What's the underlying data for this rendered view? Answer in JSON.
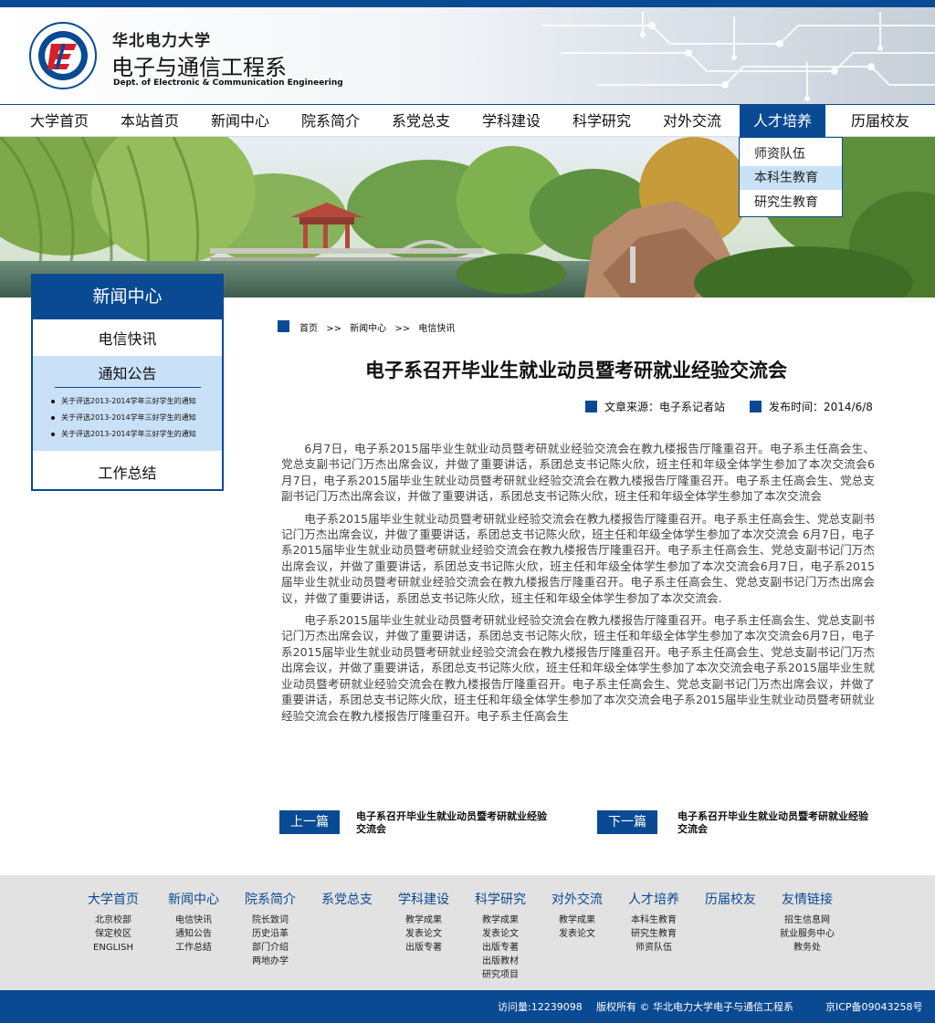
{
  "header": {
    "university_name": "华北电力大学",
    "department_title": "电子与通信工程系",
    "department_en": "Dept. of Electronic & Communication Engineering"
  },
  "nav": {
    "items": [
      "大学首页",
      "本站首页",
      "新闻中心",
      "院系简介",
      "系党总支",
      "学科建设",
      "科学研究",
      "对外交流",
      "人才培养",
      "历届校友"
    ],
    "active": "人才培养"
  },
  "dropdown": {
    "items": [
      "师资队伍",
      "本科生教育",
      "研究生教育"
    ],
    "hovered": "本科生教育"
  },
  "sidebar": {
    "title": "新闻中心",
    "item1": "电信快讯",
    "item2": "通知公告",
    "item3": "工作总结",
    "sub_items": [
      "关于评选2013-2014学年三好学生的通知",
      "关于评选2013-2014学年三好学生的通知",
      "关于评选2013-2014学年三好学生的通知"
    ]
  },
  "breadcrumb": {
    "home": "首页",
    "sep": ">>",
    "section": "新闻中心",
    "current": "电信快讯"
  },
  "article": {
    "title": "电子系召开毕业生就业动员暨考研就业经验交流会",
    "source": "文章来源：电子系记者站",
    "date": "发布时间：2014/6/8",
    "paragraphs": [
      "6月7日，电子系2015届毕业生就业动员暨考研就业经验交流会在教九楼报告厅隆重召开。电子系主任高会生、党总支副书记门万杰出席会议，并做了重要讲话，系团总支书记陈火欣，班主任和年级全体学生参加了本次交流会6月7日，电子系2015届毕业生就业动员暨考研就业经验交流会在教九楼报告厅隆重召开。电子系主任高会生、党总支副书记门万杰出席会议，并做了重要讲话，系团总支书记陈火欣，班主任和年级全体学生参加了本次交流会",
      "电子系2015届毕业生就业动员暨考研就业经验交流会在教九楼报告厅隆重召开。电子系主任高会生、党总支副书记门万杰出席会议，并做了重要讲话，系团总支书记陈火欣，班主任和年级全体学生参加了本次交流会 6月7日，电子系2015届毕业生就业动员暨考研就业经验交流会在教九楼报告厅隆重召开。电子系主任高会生、党总支副书记门万杰出席会议，并做了重要讲话，系团总支书记陈火欣，班主任和年级全体学生参加了本次交流会6月7日，电子系2015届毕业生就业动员暨考研就业经验交流会在教九楼报告厅隆重召开。电子系主任高会生、党总支副书记门万杰出席会议，并做了重要讲话，系团总支书记陈火欣，班主任和年级全体学生参加了本次交流会.",
      "电子系2015届毕业生就业动员暨考研就业经验交流会在教九楼报告厅隆重召开。电子系主任高会生、党总支副书记门万杰出席会议，并做了重要讲话，系团总支书记陈火欣，班主任和年级全体学生参加了本次交流会6月7日，电子系2015届毕业生就业动员暨考研就业经验交流会在教九楼报告厅隆重召开。电子系主任高会生、党总支副书记门万杰出席会议，并做了重要讲话，系团总支书记陈火欣，班主任和年级全体学生参加了本次交流会电子系2015届毕业生就业动员暨考研就业经验交流会在教九楼报告厅隆重召开。电子系主任高会生、党总支副书记门万杰出席会议，并做了重要讲话，系团总支书记陈火欣，班主任和年级全体学生参加了本次交流会电子系2015届毕业生就业动员暨考研就业经验交流会在教九楼报告厅隆重召开。电子系主任高会生"
    ]
  },
  "pager": {
    "prev_label": "上一篇",
    "prev_title": "电子系召开毕业生就业动员暨考研就业经验交流会",
    "next_label": "下一篇",
    "next_title": "电子系召开毕业生就业动员暨考研就业经验交流会"
  },
  "footer": {
    "columns": [
      {
        "title": "大学首页",
        "links": [
          "北京校部",
          "保定校区",
          "ENGLISH"
        ]
      },
      {
        "title": "新闻中心",
        "links": [
          "电信快讯",
          "通知公告",
          "工作总结"
        ]
      },
      {
        "title": "院系简介",
        "links": [
          "院长致词",
          "历史沿革",
          "部门介绍",
          "两地办学"
        ]
      },
      {
        "title": "系党总支",
        "links": []
      },
      {
        "title": "学科建设",
        "links": [
          "教学成果",
          "发表论文",
          "出版专著"
        ]
      },
      {
        "title": "科学研究",
        "links": [
          "教学成果",
          "发表论文",
          "出版专著",
          "出版教材",
          "研究项目"
        ]
      },
      {
        "title": "对外交流",
        "links": [
          "教学成果",
          "发表论文"
        ]
      },
      {
        "title": "人才培养",
        "links": [
          "本科生教育",
          "研究生教育",
          "师资队伍"
        ]
      },
      {
        "title": "历届校友",
        "links": []
      },
      {
        "title": "友情链接",
        "links": [
          "招生信息网",
          "就业服务中心",
          "教务处"
        ]
      }
    ],
    "visits": "访问量:12239098",
    "copyright": "版权所有 © 华北电力大学电子与通信工程系",
    "icp": "京ICP备09043258号"
  },
  "colors": {
    "brand_blue": "#0a4a93",
    "highlight_blue": "#c8e1f7",
    "footer_gray": "#e2e2e2"
  },
  "icons": [
    "university-logo",
    "square-bullet-icon",
    "dot-bullet-icon"
  ]
}
